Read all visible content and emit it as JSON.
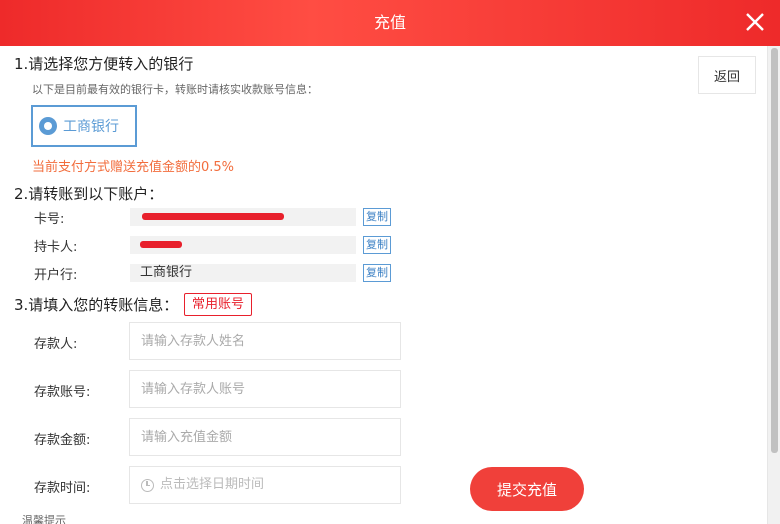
{
  "header": {
    "title": "充值"
  },
  "step1": {
    "title": "1.请选择您方便转入的银行",
    "hint": "以下是目前最有效的银行卡，转账时请核实收款账号信息：",
    "bank_option": "工商银行",
    "promo": "当前支付方式赠送充值金额的0.5%"
  },
  "back_label": "返回",
  "step2": {
    "title": "2.请转账到以下账户：",
    "rows": [
      {
        "label": "卡号:",
        "value": "",
        "copy": "复制"
      },
      {
        "label": "持卡人:",
        "value": "",
        "copy": "复制"
      },
      {
        "label": "开户行:",
        "value": "工商银行",
        "copy": "复制"
      }
    ]
  },
  "step3": {
    "title": "3.请填入您的转账信息：",
    "common_account": "常用账号",
    "fields": [
      {
        "label": "存款人:",
        "placeholder": "请输入存款人姓名"
      },
      {
        "label": "存款账号:",
        "placeholder": "请输入存款人账号"
      },
      {
        "label": "存款金额:",
        "placeholder": "请输入充值金额"
      },
      {
        "label": "存款时间:",
        "placeholder": "点击选择日期时间"
      }
    ]
  },
  "submit_label": "提交充值",
  "tips_label": "温馨提示",
  "colors": {
    "header": "#ee2a2a",
    "accent_blue": "#5b9bd5",
    "promo": "#f26d3d",
    "submit": "#f0403a"
  }
}
